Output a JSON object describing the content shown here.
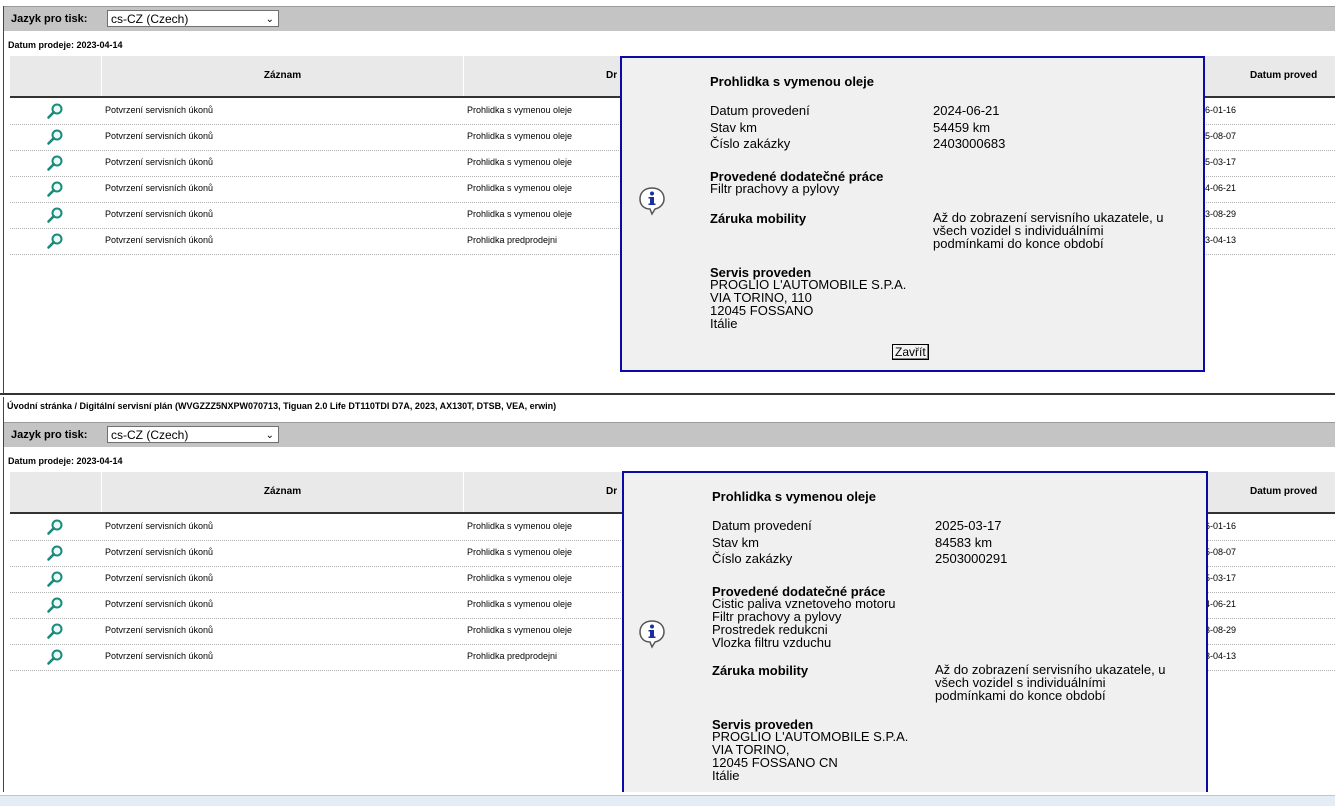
{
  "lang_label": "Jazyk pro tisk:",
  "lang_value": "cs-CZ (Czech)",
  "sale_date": "Datum prodeje: 2023-04-14",
  "breadcrumb": "Úvodní stránka / Digitální servisní plán (WVGZZZ5NXPW070713, Tiguan 2.0 Life DT110TDI D7A, 2023, AX130T, DTSB, VEA, erwin)",
  "columns": {
    "record": "Záznam",
    "description": "Dr",
    "date": "Datum proved"
  },
  "rows": [
    {
      "record": "Potvrzení servisních úkonů",
      "description": "Prohlidka s vymenou oleje",
      "date": "6-01-16"
    },
    {
      "record": "Potvrzení servisních úkonů",
      "description": "Prohlidka s vymenou oleje",
      "date": "5-08-07"
    },
    {
      "record": "Potvrzení servisních úkonů",
      "description": "Prohlidka s vymenou oleje",
      "date": "5-03-17"
    },
    {
      "record": "Potvrzení servisních úkonů",
      "description": "Prohlidka s vymenou oleje",
      "date": "4-06-21"
    },
    {
      "record": "Potvrzení servisních úkonů",
      "description": "Prohlidka s vymenou oleje",
      "date": "3-08-29"
    },
    {
      "record": "Potvrzení servisních úkonů",
      "description": "Prohlidka predprodejni",
      "date": "3-04-13"
    }
  ],
  "popup1": {
    "title": "Prohlidka s vymenou oleje",
    "date_label": "Datum provedení",
    "date_value": "2024-06-21",
    "km_label": "Stav km",
    "km_value": "54459 km",
    "order_label": "Číslo zakázky",
    "order_value": "2403000683",
    "extra_header": "Provedené dodatečné práce",
    "extra_items": [
      "Filtr prachovy a pylovy"
    ],
    "mobility_label": "Záruka mobility",
    "mobility_lines": [
      "Až do zobrazení servisního ukazatele, u",
      "všech vozidel s individuálními",
      "podmínkami do konce období"
    ],
    "service_header": "Servis proveden",
    "service_lines": [
      "PROGLIO L'AUTOMOBILE S.P.A.",
      "VIA TORINO, 110",
      "12045 FOSSANO",
      "Itálie"
    ],
    "close": "Zavřít"
  },
  "popup2": {
    "title": "Prohlidka s vymenou oleje",
    "date_label": "Datum provedení",
    "date_value": "2025-03-17",
    "km_label": "Stav km",
    "km_value": "84583 km",
    "order_label": "Číslo zakázky",
    "order_value": "2503000291",
    "extra_header": "Provedené dodatečné práce",
    "extra_items": [
      "Cistic paliva vznetoveho motoru",
      "Filtr prachovy a pylovy",
      "Prostredek redukcni",
      "Vlozka filtru vzduchu"
    ],
    "mobility_label": "Záruka mobility",
    "mobility_lines": [
      "Až do zobrazení servisního ukazatele, u",
      "všech vozidel s individuálními",
      "podmínkami do konce období"
    ],
    "service_header": "Servis proveden",
    "service_lines": [
      "PROGLIO L'AUTOMOBILE S.P.A.",
      "VIA TORINO,",
      "12045 FOSSANO CN",
      "Itálie"
    ]
  },
  "colors": {
    "popup_border": "#0a0aa8",
    "langbar": "#c4c4c4",
    "header": "#e9e9e9",
    "icon_teal": "#1a8a7a",
    "info_blue": "#1a2fa0"
  },
  "icons": {
    "view": "magnifier-icon",
    "info": "info-icon"
  }
}
